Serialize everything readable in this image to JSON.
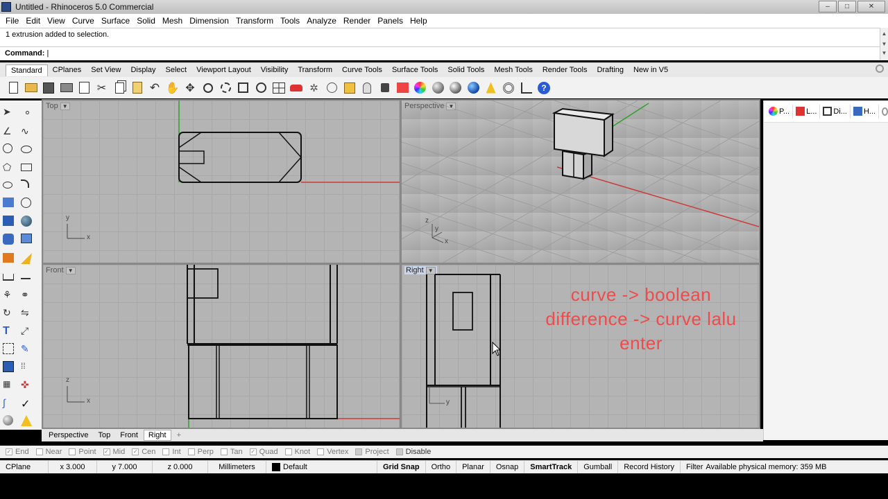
{
  "window": {
    "title": "Untitled - Rhinoceros 5.0 Commercial",
    "controls": [
      "–",
      "□",
      "✕"
    ]
  },
  "menu": [
    "File",
    "Edit",
    "View",
    "Curve",
    "Surface",
    "Solid",
    "Mesh",
    "Dimension",
    "Transform",
    "Tools",
    "Analyze",
    "Render",
    "Panels",
    "Help"
  ],
  "command": {
    "history": "1 extrusion added to selection.",
    "prompt": "Command:"
  },
  "toolbar_tabs": [
    {
      "label": "Standard",
      "active": true
    },
    {
      "label": "CPlanes"
    },
    {
      "label": "Set View"
    },
    {
      "label": "Display"
    },
    {
      "label": "Select"
    },
    {
      "label": "Viewport Layout"
    },
    {
      "label": "Visibility"
    },
    {
      "label": "Transform"
    },
    {
      "label": "Curve Tools"
    },
    {
      "label": "Surface Tools"
    },
    {
      "label": "Solid Tools"
    },
    {
      "label": "Mesh Tools"
    },
    {
      "label": "Render Tools"
    },
    {
      "label": "Drafting"
    },
    {
      "label": "New in V5"
    }
  ],
  "viewports": {
    "top": {
      "label": "Top"
    },
    "perspective": {
      "label": "Perspective"
    },
    "front": {
      "label": "Front"
    },
    "right": {
      "label": "Right"
    }
  },
  "axes": {
    "x": "x",
    "y": "y",
    "z": "z"
  },
  "annotation": {
    "line1": "curve -> boolean",
    "line2": "difference -> curve lalu",
    "line3": "enter"
  },
  "right_panel": {
    "tabs": [
      "P...",
      "L...",
      "Di...",
      "H..."
    ]
  },
  "viewport_tabs": [
    {
      "label": "Perspective"
    },
    {
      "label": "Top"
    },
    {
      "label": "Front"
    },
    {
      "label": "Right",
      "active": true
    },
    {
      "label": "+"
    }
  ],
  "osnaps": [
    {
      "label": "End",
      "checked": true
    },
    {
      "label": "Near",
      "checked": false
    },
    {
      "label": "Point",
      "checked": false
    },
    {
      "label": "Mid",
      "checked": true
    },
    {
      "label": "Cen",
      "checked": true
    },
    {
      "label": "Int",
      "checked": false
    },
    {
      "label": "Perp",
      "checked": false
    },
    {
      "label": "Tan",
      "checked": false
    },
    {
      "label": "Quad",
      "checked": true
    },
    {
      "label": "Knot",
      "checked": false
    },
    {
      "label": "Vertex",
      "checked": false
    },
    {
      "label": "Project",
      "checked": false
    },
    {
      "label": "Disable",
      "checked": false
    }
  ],
  "status": {
    "cplane": "CPlane",
    "x": "x 3.000",
    "y": "y 7.000",
    "z": "z 0.000",
    "units": "Millimeters",
    "layer": "Default",
    "grid_snap": "Grid Snap",
    "ortho": "Ortho",
    "planar": "Planar",
    "osnap": "Osnap",
    "smarttrack": "SmartTrack",
    "gumball": "Gumball",
    "record_history": "Record History",
    "filter": "Filter",
    "memory": "Available physical memory: 359 MB"
  },
  "colors": {
    "viewport_bg": "#b4b4b4",
    "grid": "#a8a8a8",
    "x_axis": "#cc3a3a",
    "y_axis": "#30a030",
    "annotation": "#ee4b4b"
  }
}
